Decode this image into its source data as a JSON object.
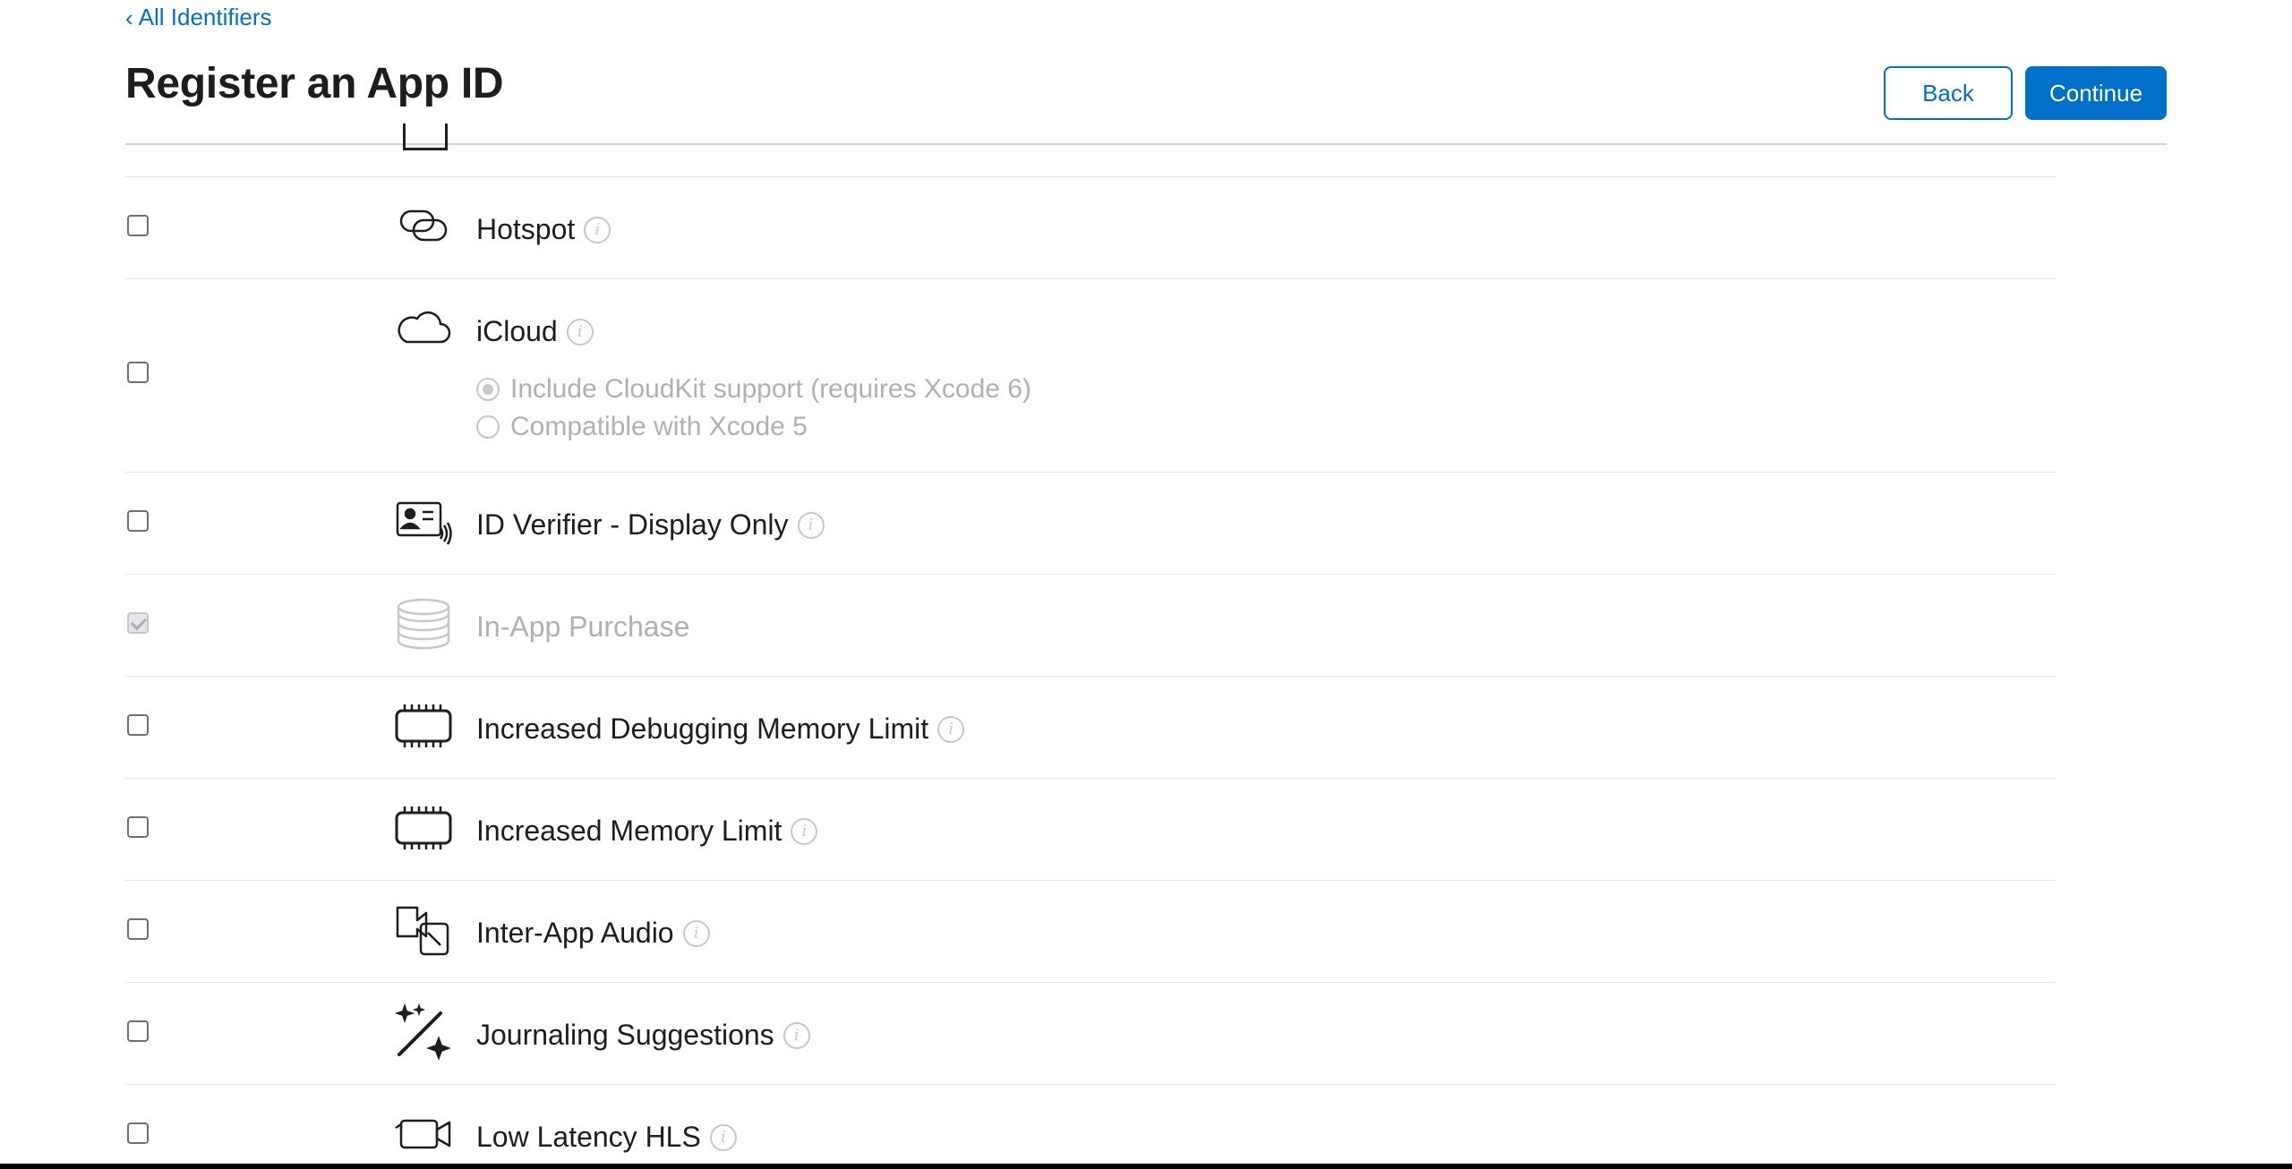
{
  "header": {
    "back_link": "All Identifiers",
    "title": "Register an App ID",
    "back_button": "Back",
    "continue_button": "Continue"
  },
  "capabilities": [
    {
      "label": "Hotspot",
      "icon": "hotspot-icon",
      "checked": false,
      "disabled": false
    },
    {
      "label": "iCloud",
      "icon": "cloud-icon",
      "checked": false,
      "disabled": false,
      "options": [
        {
          "label": "Include CloudKit support (requires Xcode 6)",
          "selected": true
        },
        {
          "label": "Compatible with Xcode 5",
          "selected": false
        }
      ]
    },
    {
      "label": "ID Verifier - Display Only",
      "icon": "id-card-icon",
      "checked": false,
      "disabled": false
    },
    {
      "label": "In-App Purchase",
      "icon": "coins-icon",
      "checked": true,
      "disabled": true
    },
    {
      "label": "Increased Debugging Memory Limit",
      "icon": "memory-chip-icon",
      "checked": false,
      "disabled": false
    },
    {
      "label": "Increased Memory Limit",
      "icon": "memory-chip-icon",
      "checked": false,
      "disabled": false
    },
    {
      "label": "Inter-App Audio",
      "icon": "inter-app-audio-icon",
      "checked": false,
      "disabled": false
    },
    {
      "label": "Journaling Suggestions",
      "icon": "magic-wand-icon",
      "checked": false,
      "disabled": false
    },
    {
      "label": "Low Latency HLS",
      "icon": "video-camera-icon",
      "checked": false,
      "disabled": false
    }
  ],
  "colors": {
    "accent": "#0070c9",
    "text": "#1d1d1f",
    "disabled_text": "#b0b0b5",
    "divider": "#e5e5e5"
  }
}
